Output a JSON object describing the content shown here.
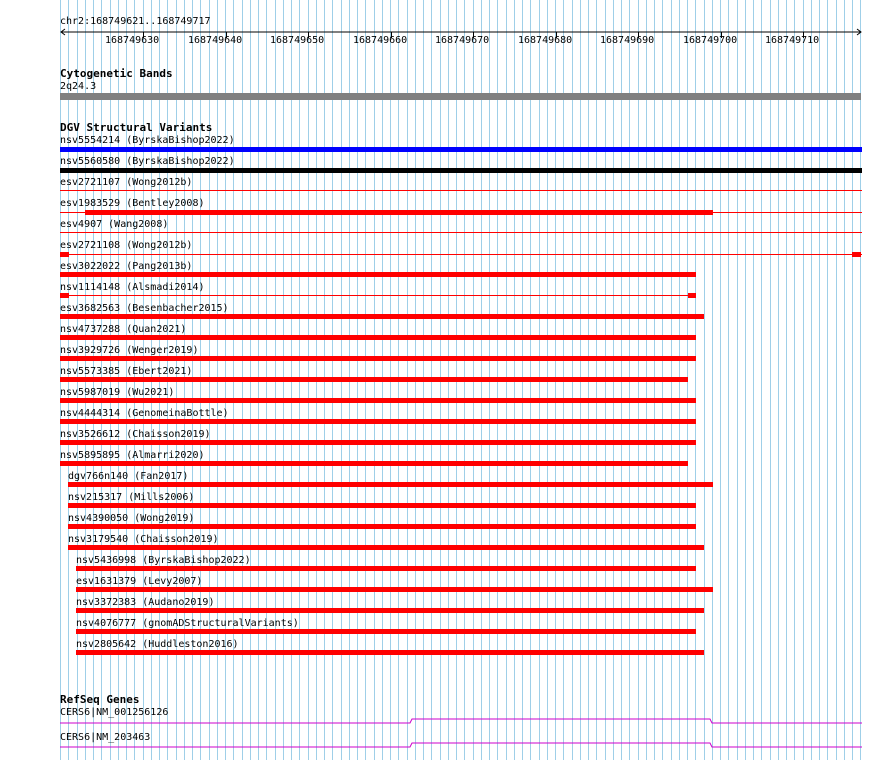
{
  "ruler": {
    "locus": "chr2:168749621..168749717",
    "ticks": [
      "168749630",
      "168749640",
      "168749650",
      "168749660",
      "168749670",
      "168749680",
      "168749690",
      "168749700",
      "168749710"
    ]
  },
  "cytoband": {
    "title": "Cytogenetic Bands",
    "label": "2q24.3",
    "color": "#808080"
  },
  "dgv": {
    "title": "DGV Structural Variants",
    "colors": {
      "gain": "#0000ff",
      "complex": "#000000",
      "loss": "#ff0000"
    },
    "variants": [
      {
        "label": "nsv5554214 (ByrskaBishop2022)",
        "kind": "gain"
      },
      {
        "label": "nsv5560580 (ByrskaBishop2022)",
        "kind": "complex"
      },
      {
        "label": "esv2721107 (Wong2012b)",
        "kind": "loss"
      },
      {
        "label": "esv1983529 (Bentley2008)",
        "kind": "loss"
      },
      {
        "label": "esv4907 (Wang2008)",
        "kind": "loss"
      },
      {
        "label": "esv2721108 (Wong2012b)",
        "kind": "loss"
      },
      {
        "label": "esv3022022 (Pang2013b)",
        "kind": "loss"
      },
      {
        "label": "nsv1114148 (Alsmadi2014)",
        "kind": "loss"
      },
      {
        "label": "esv3682563 (Besenbacher2015)",
        "kind": "loss"
      },
      {
        "label": "nsv4737288 (Quan2021)",
        "kind": "loss"
      },
      {
        "label": "nsv3929726 (Wenger2019)",
        "kind": "loss"
      },
      {
        "label": "nsv5573385 (Ebert2021)",
        "kind": "loss"
      },
      {
        "label": "nsv5987019 (Wu2021)",
        "kind": "loss"
      },
      {
        "label": "nsv4444314 (GenomeinaBottle)",
        "kind": "loss"
      },
      {
        "label": "nsv3526612 (Chaisson2019)",
        "kind": "loss"
      },
      {
        "label": "nsv5895895 (Almarri2020)",
        "kind": "loss"
      },
      {
        "label": "dgv766n140 (Fan2017)",
        "kind": "loss"
      },
      {
        "label": "nsv215317 (Mills2006)",
        "kind": "loss"
      },
      {
        "label": "nsv4390050 (Wong2019)",
        "kind": "loss"
      },
      {
        "label": "nsv3179540 (Chaisson2019)",
        "kind": "loss"
      },
      {
        "label": "nsv5436998 (ByrskaBishop2022)",
        "kind": "loss"
      },
      {
        "label": "esv1631379 (Levy2007)",
        "kind": "loss"
      },
      {
        "label": "nsv3372383 (Audano2019)",
        "kind": "loss"
      },
      {
        "label": "nsv4076777 (gnomADStructuralVariants)",
        "kind": "loss"
      },
      {
        "label": "nsv2805642 (Huddleston2016)",
        "kind": "loss"
      }
    ]
  },
  "refseq": {
    "title": "RefSeq Genes",
    "color": "#cc00cc",
    "genes": [
      {
        "label": "CERS6|NM_001256126"
      },
      {
        "label": "CERS6|NM_203463"
      }
    ]
  }
}
